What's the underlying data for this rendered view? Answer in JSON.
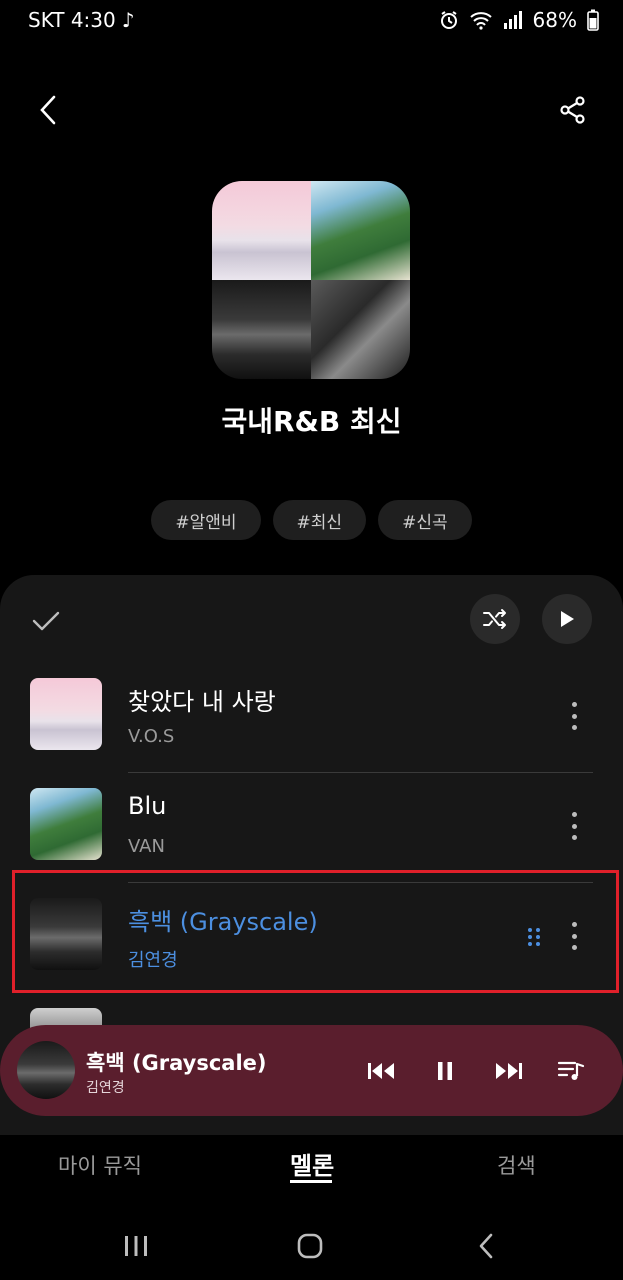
{
  "status_bar": {
    "carrier_time": "SKT 4:30",
    "music_note": "♪",
    "battery": "68%"
  },
  "header": {
    "back_icon": "back-arrow-icon",
    "share_icon": "share-icon"
  },
  "playlist": {
    "title": "국내R&B 최신",
    "tags": [
      "#알앤비",
      "#최신",
      "#신곡"
    ]
  },
  "list_controls": {
    "select_icon": "check-icon",
    "shuffle_icon": "shuffle-icon",
    "play_icon": "play-icon"
  },
  "songs": [
    {
      "title": "찾았다 내 사랑",
      "artist": "V.O.S",
      "active": false
    },
    {
      "title": "Blu",
      "artist": "VAN",
      "active": false
    },
    {
      "title": "흑백 (Grayscale)",
      "artist": "김연경",
      "active": true
    }
  ],
  "mini_player": {
    "title": "흑백 (Grayscale)",
    "artist": "김연경",
    "controls": [
      "previous-icon",
      "pause-icon",
      "next-icon",
      "playlist-icon"
    ]
  },
  "bottom_nav": {
    "tabs": [
      "마이 뮤직",
      "멜론",
      "검색"
    ],
    "selected": "멜론"
  },
  "system_nav": [
    "recents-icon",
    "home-icon",
    "back-icon"
  ],
  "colors": {
    "accent_blue": "#4c8fe0",
    "mini_player_bg": "#5a1e2d",
    "highlight_red": "#e0202a"
  }
}
